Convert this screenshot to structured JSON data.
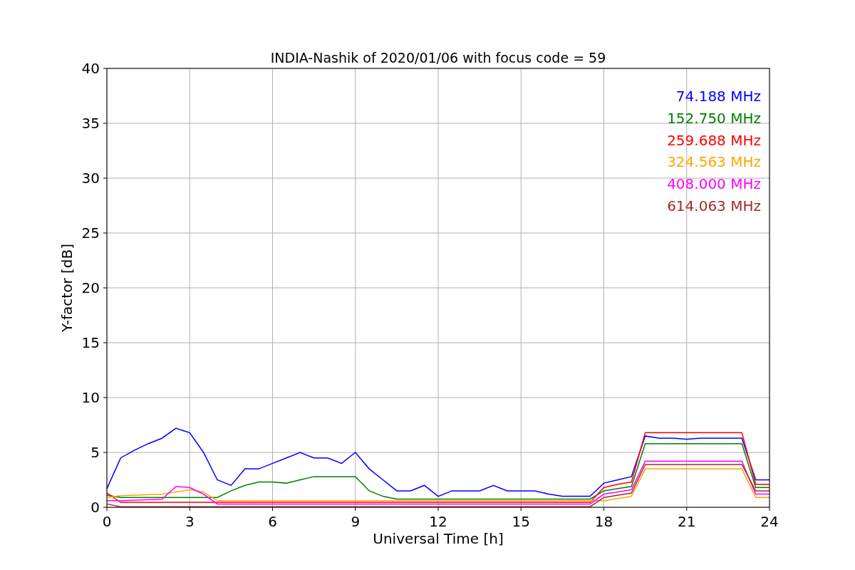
{
  "chart_data": {
    "type": "line",
    "title": "INDIA-Nashik of 2020/01/06 with focus code = 59",
    "xlabel": "Universal Time [h]",
    "ylabel": "Y-factor [dB]",
    "grid": true,
    "x": [
      0,
      0.5,
      1,
      1.5,
      2,
      2.5,
      3,
      3.5,
      4,
      4.5,
      5,
      5.5,
      6,
      6.5,
      7,
      7.5,
      8,
      8.5,
      9,
      9.5,
      10,
      10.5,
      11,
      11.5,
      12,
      12.5,
      13,
      13.5,
      14,
      14.5,
      15,
      15.5,
      16,
      16.5,
      17,
      17.5,
      18,
      18.5,
      19,
      19.5,
      20,
      20.5,
      21,
      21.5,
      22,
      22.5,
      23,
      23.5,
      24
    ],
    "xlim": [
      0,
      24
    ],
    "ylim": [
      0,
      40
    ],
    "xticks": [
      0,
      3,
      6,
      9,
      12,
      15,
      18,
      21,
      24
    ],
    "yticks": [
      0,
      5,
      10,
      15,
      20,
      25,
      30,
      35,
      40
    ],
    "series": [
      {
        "name": "74.188 MHz",
        "color": "#0000ff",
        "values": [
          1.7,
          4.5,
          5.2,
          5.8,
          6.3,
          7.2,
          6.8,
          5.0,
          2.5,
          2.0,
          3.5,
          3.5,
          4.0,
          4.5,
          5.0,
          4.5,
          4.5,
          4.0,
          5.0,
          3.5,
          2.5,
          1.5,
          1.5,
          2.0,
          1.0,
          1.5,
          1.5,
          1.5,
          2.0,
          1.5,
          1.5,
          1.5,
          1.2,
          1.0,
          1.0,
          1.0,
          2.2,
          2.5,
          2.8,
          6.5,
          6.3,
          6.3,
          6.2,
          6.3,
          6.3,
          6.3,
          6.3,
          2.5,
          2.5
        ]
      },
      {
        "name": "152.750 MHz",
        "color": "#008000",
        "values": [
          1.1,
          0.9,
          0.9,
          0.9,
          0.9,
          0.9,
          0.9,
          0.9,
          0.9,
          1.5,
          2.0,
          2.3,
          2.3,
          2.2,
          2.5,
          2.8,
          2.8,
          2.8,
          2.8,
          1.5,
          1.0,
          0.75,
          0.75,
          0.75,
          0.75,
          0.75,
          0.75,
          0.75,
          0.75,
          0.75,
          0.75,
          0.75,
          0.75,
          0.75,
          0.75,
          0.75,
          1.5,
          1.7,
          1.9,
          5.8,
          5.8,
          5.8,
          5.8,
          5.8,
          5.8,
          5.8,
          5.8,
          1.8,
          1.8
        ]
      },
      {
        "name": "259.688 MHz",
        "color": "#ff0000",
        "values": [
          1.3,
          0.45,
          0.45,
          0.45,
          0.45,
          0.45,
          0.45,
          0.45,
          0.45,
          0.45,
          0.45,
          0.45,
          0.45,
          0.45,
          0.45,
          0.45,
          0.45,
          0.45,
          0.45,
          0.45,
          0.45,
          0.45,
          0.45,
          0.45,
          0.45,
          0.45,
          0.45,
          0.45,
          0.45,
          0.45,
          0.45,
          0.45,
          0.45,
          0.45,
          0.45,
          0.45,
          1.8,
          2.1,
          2.3,
          6.8,
          6.8,
          6.8,
          6.8,
          6.8,
          6.8,
          6.8,
          6.8,
          2.1,
          2.1
        ]
      },
      {
        "name": "324.563 MHz",
        "color": "#ffa500",
        "values": [
          0.9,
          1.05,
          1.1,
          1.15,
          1.2,
          1.4,
          1.6,
          1.4,
          0.6,
          0.6,
          0.6,
          0.6,
          0.6,
          0.6,
          0.6,
          0.6,
          0.6,
          0.6,
          0.6,
          0.6,
          0.6,
          0.6,
          0.6,
          0.6,
          0.6,
          0.6,
          0.6,
          0.6,
          0.6,
          0.6,
          0.6,
          0.6,
          0.6,
          0.6,
          0.6,
          0.6,
          0.6,
          0.8,
          1.0,
          3.5,
          3.5,
          3.5,
          3.5,
          3.5,
          3.5,
          3.5,
          3.5,
          0.9,
          0.9
        ]
      },
      {
        "name": "408.000 MHz",
        "color": "#ff00ff",
        "values": [
          0.6,
          0.6,
          0.65,
          0.7,
          0.75,
          1.9,
          1.8,
          1.2,
          0.3,
          0.3,
          0.3,
          0.3,
          0.3,
          0.3,
          0.3,
          0.3,
          0.3,
          0.3,
          0.3,
          0.3,
          0.3,
          0.3,
          0.3,
          0.3,
          0.3,
          0.3,
          0.3,
          0.3,
          0.3,
          0.3,
          0.3,
          0.3,
          0.3,
          0.3,
          0.3,
          0.3,
          1.2,
          1.4,
          1.6,
          4.2,
          4.2,
          4.2,
          4.2,
          4.2,
          4.2,
          4.2,
          4.2,
          1.2,
          1.2
        ]
      },
      {
        "name": "614.063 MHz",
        "color": "#a52a2a",
        "values": [
          0.3,
          0.05,
          0.05,
          0.05,
          0.05,
          0.05,
          0.05,
          0.05,
          0.05,
          0.05,
          0.05,
          0.05,
          0.05,
          0.05,
          0.05,
          0.05,
          0.05,
          0.05,
          0.05,
          0.05,
          0.05,
          0.05,
          0.05,
          0.05,
          0.05,
          0.05,
          0.05,
          0.05,
          0.05,
          0.05,
          0.05,
          0.05,
          0.05,
          0.05,
          0.05,
          0.05,
          0.9,
          1.1,
          1.3,
          3.9,
          3.9,
          3.9,
          3.9,
          3.9,
          3.9,
          3.9,
          3.9,
          1.5,
          1.5
        ]
      }
    ]
  }
}
